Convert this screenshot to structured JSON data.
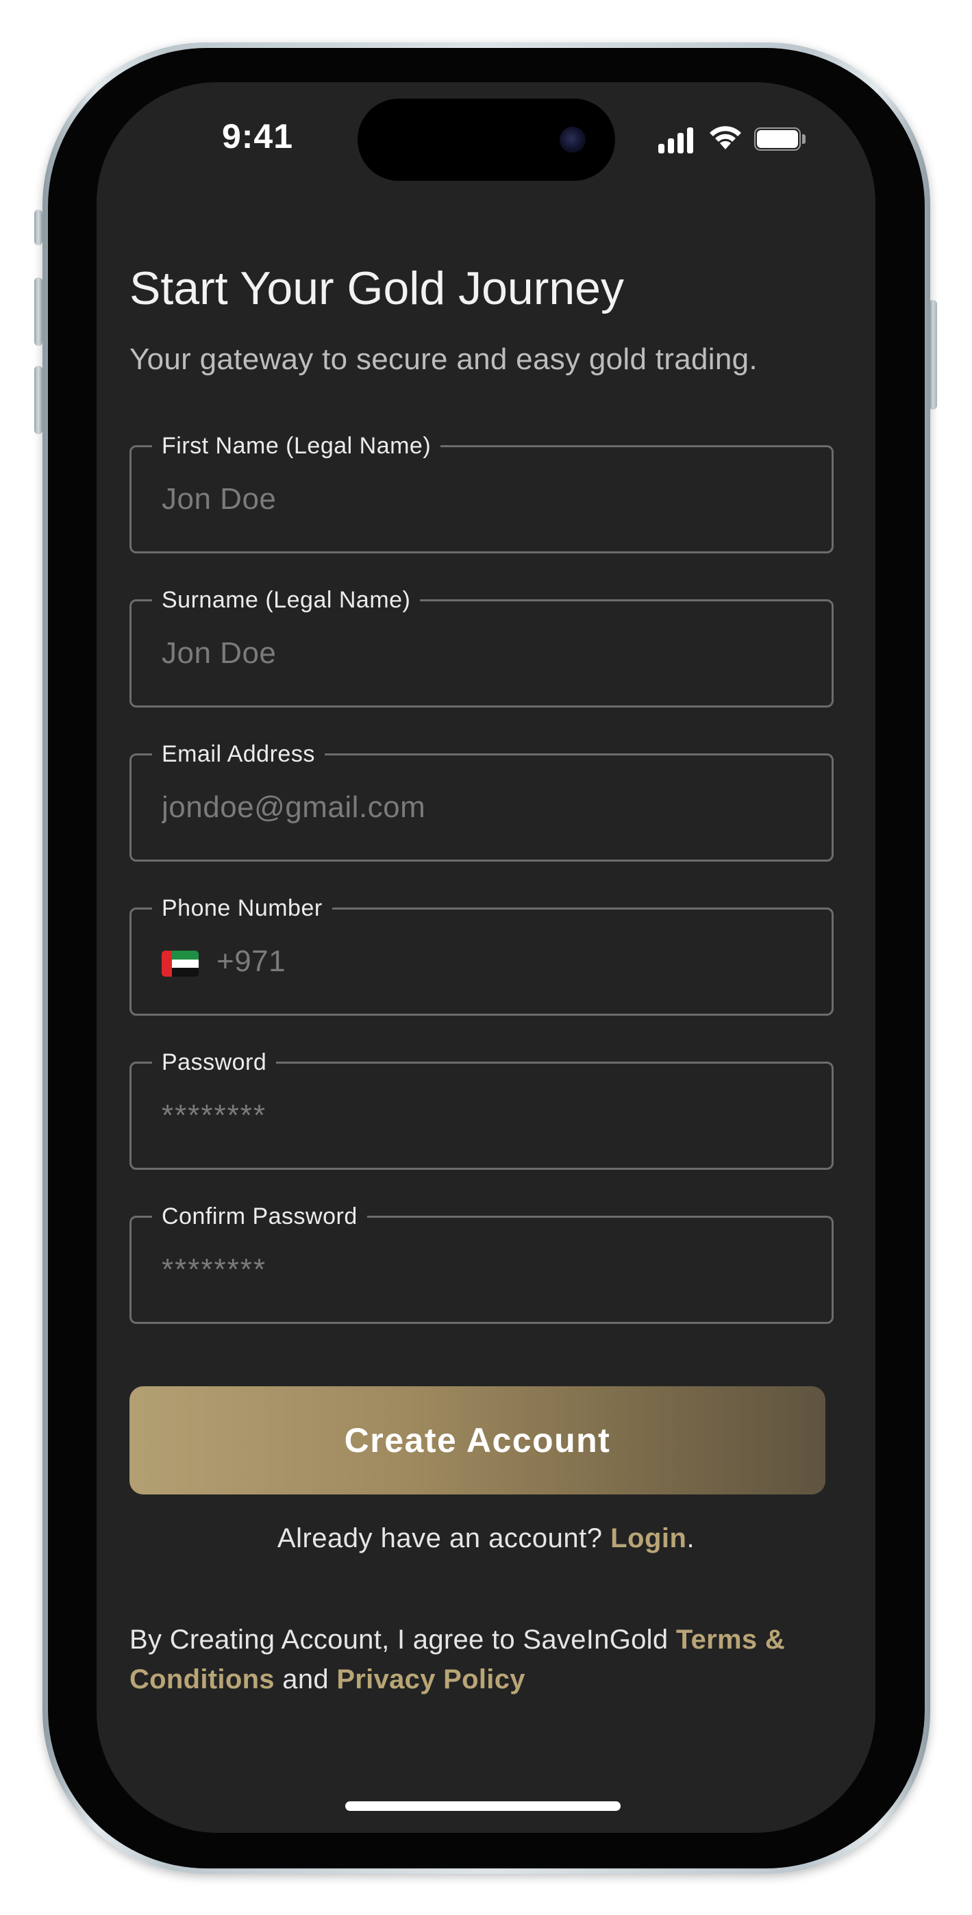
{
  "status_bar": {
    "time": "9:41",
    "icons": [
      "cellular-signal-icon",
      "wifi-icon",
      "battery-icon"
    ]
  },
  "header": {
    "title": "Start Your Gold Journey",
    "subtitle": "Your gateway to secure and easy gold trading."
  },
  "form": {
    "first_name": {
      "label": "First Name (Legal Name)",
      "placeholder": "Jon Doe"
    },
    "surname": {
      "label": "Surname (Legal Name)",
      "placeholder": "Jon Doe"
    },
    "email": {
      "label": "Email Address",
      "placeholder": "jondoe@gmail.com"
    },
    "phone": {
      "label": "Phone Number",
      "placeholder": "+971",
      "flag": "uae-flag-icon"
    },
    "password": {
      "label": "Password",
      "placeholder": "********"
    },
    "confirm_password": {
      "label": "Confirm Password",
      "placeholder": "********"
    }
  },
  "actions": {
    "create_account_label": "Create Account",
    "login_prompt": "Already have an account? ",
    "login_link": "Login",
    "login_suffix": "."
  },
  "terms": {
    "prefix": "By Creating Account, I agree to SaveInGold ",
    "terms_link": "Terms & Conditions",
    "middle": " and ",
    "privacy_link": "Privacy Policy"
  },
  "colors": {
    "background": "#232323",
    "accent_gold": "#b9a576",
    "border": "#6c6c6c",
    "button_gradient_start": "#b29f72",
    "button_gradient_end": "#5f5440"
  }
}
